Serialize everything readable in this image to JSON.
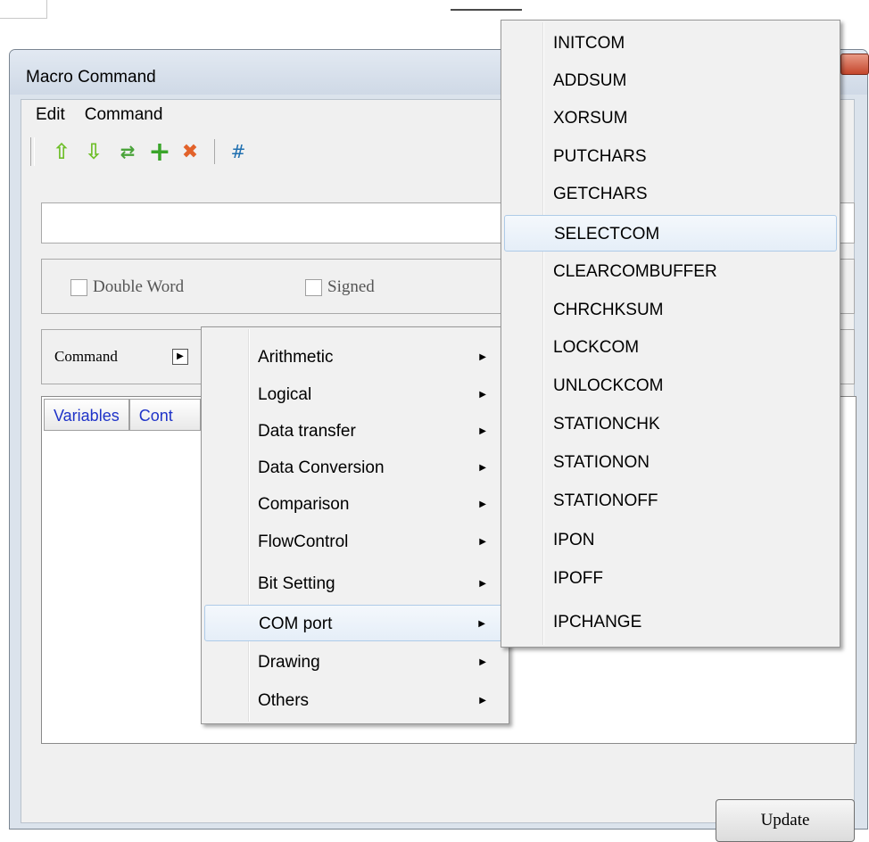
{
  "window": {
    "title": "Macro Command",
    "menubar": [
      "Edit",
      "Command"
    ],
    "toolbar": {
      "move_up_icon": "⇧",
      "move_down_icon": "⇩",
      "swap_icon": "⇄",
      "add_icon": "+",
      "delete_icon": "✖",
      "hash_label": "#"
    },
    "options": {
      "double_word": "Double Word",
      "signed": "Signed"
    },
    "command_label": "Command",
    "columns": [
      "Variables",
      "Cont"
    ],
    "update_button": "Update"
  },
  "context_menu": {
    "items": [
      "Arithmetic",
      "Logical",
      "Data transfer",
      "Data Conversion",
      "Comparison",
      "FlowControl",
      "Bit Setting",
      "COM port",
      "Drawing",
      "Others"
    ],
    "highlighted": "COM port"
  },
  "com_port_submenu": {
    "items": [
      "INITCOM",
      "ADDSUM",
      "XORSUM",
      "PUTCHARS",
      "GETCHARS",
      "SELECTCOM",
      "CLEARCOMBUFFER",
      "CHRCHKSUM",
      "LOCKCOM",
      "UNLOCKCOM",
      "STATIONCHK",
      "STATIONON",
      "STATIONOFF",
      "IPON",
      "IPOFF",
      "IPCHANGE"
    ],
    "highlighted": "SELECTCOM"
  },
  "colors": {
    "arrow_up": "#6fbf2a",
    "arrow_down": "#6fbf2a",
    "add": "#3aa52a",
    "delete": "#e2622a",
    "hash": "#1f6fb0",
    "column_header_text": "#1f33c8"
  }
}
